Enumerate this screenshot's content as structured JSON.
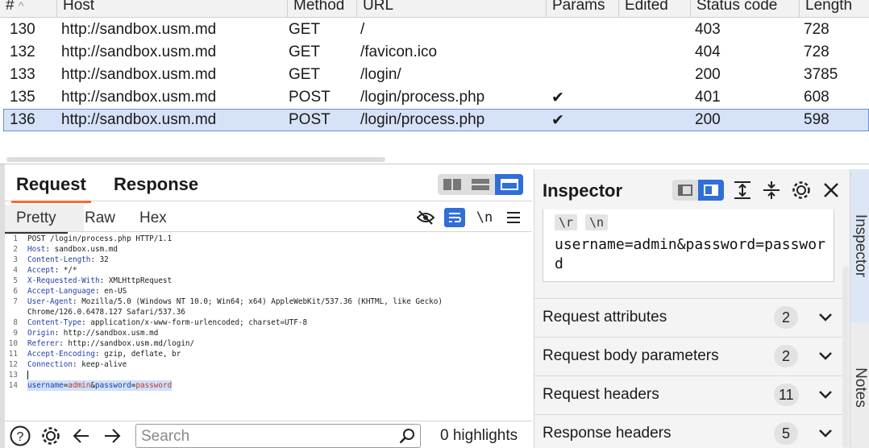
{
  "history": {
    "columns": [
      "#",
      "Host",
      "Method",
      "URL",
      "Params",
      "Edited",
      "Status code",
      "Length"
    ],
    "sort_indicator": "^",
    "rows": [
      {
        "id": "130",
        "host": "http://sandbox.usm.md",
        "method": "GET",
        "url": "/",
        "params": "",
        "edited": "",
        "status": "403",
        "length": "728"
      },
      {
        "id": "132",
        "host": "http://sandbox.usm.md",
        "method": "GET",
        "url": "/favicon.ico",
        "params": "",
        "edited": "",
        "status": "404",
        "length": "728"
      },
      {
        "id": "133",
        "host": "http://sandbox.usm.md",
        "method": "GET",
        "url": "/login/",
        "params": "",
        "edited": "",
        "status": "200",
        "length": "3785"
      },
      {
        "id": "135",
        "host": "http://sandbox.usm.md",
        "method": "POST",
        "url": "/login/process.php",
        "params": "✔",
        "edited": "",
        "status": "401",
        "length": "608"
      },
      {
        "id": "136",
        "host": "http://sandbox.usm.md",
        "method": "POST",
        "url": "/login/process.php",
        "params": "✔",
        "edited": "",
        "status": "200",
        "length": "598"
      }
    ],
    "selected_id": "136"
  },
  "request_pane": {
    "tabs": [
      "Request",
      "Response"
    ],
    "active_tab": "Request",
    "view_tabs": [
      "Pretty",
      "Raw",
      "Hex"
    ],
    "active_view": "Pretty",
    "newline_toggle": "\\n",
    "lines": [
      {
        "n": "1",
        "key": "",
        "value": "POST /login/process.php HTTP/1.1"
      },
      {
        "n": "2",
        "key": "Host",
        "value": " sandbox.usm.md"
      },
      {
        "n": "3",
        "key": "Content-Length",
        "value": " 32"
      },
      {
        "n": "4",
        "key": "Accept",
        "value": " */*"
      },
      {
        "n": "5",
        "key": "X-Requested-With",
        "value": " XMLHttpRequest"
      },
      {
        "n": "6",
        "key": "Accept-Language",
        "value": " en-US"
      },
      {
        "n": "7",
        "key": "User-Agent",
        "value": " Mozilla/5.0 (Windows NT 10.0; Win64; x64) AppleWebKit/537.36 (KHTML, like Gecko)"
      },
      {
        "n": "",
        "key": "",
        "value": "Chrome/126.0.6478.127 Safari/537.36"
      },
      {
        "n": "8",
        "key": "Content-Type",
        "value": " application/x-www-form-urlencoded; charset=UTF-8"
      },
      {
        "n": "9",
        "key": "Origin",
        "value": " http://sandbox.usm.md"
      },
      {
        "n": "10",
        "key": "Referer",
        "value": " http://sandbox.usm.md/login/"
      },
      {
        "n": "11",
        "key": "Accept-Encoding",
        "value": " gzip, deflate, br"
      },
      {
        "n": "12",
        "key": "Connection",
        "value": " keep-alive"
      },
      {
        "n": "13",
        "key": "",
        "value": ""
      }
    ],
    "body_line": {
      "n": "14",
      "k1": "username",
      "v1": "admin",
      "k2": "password",
      "v2": "password"
    },
    "search_placeholder": "Search",
    "highlights": "0 highlights"
  },
  "inspector": {
    "title": "Inspector",
    "escape_chips": [
      "\\r",
      "\\n"
    ],
    "body_text": "username=admin&password=password",
    "sections": [
      {
        "label": "Request attributes",
        "count": "2"
      },
      {
        "label": "Request body parameters",
        "count": "2"
      },
      {
        "label": "Request headers",
        "count": "11"
      },
      {
        "label": "Response headers",
        "count": "5"
      }
    ]
  },
  "side_tabs": [
    "Inspector",
    "Notes"
  ],
  "colors": {
    "accent": "#2f6fd6",
    "tab_underline": "#ff6633",
    "selected_row": "#d6e2f7",
    "header_key": "#1f3fa8",
    "param_value": "#c0392b"
  }
}
